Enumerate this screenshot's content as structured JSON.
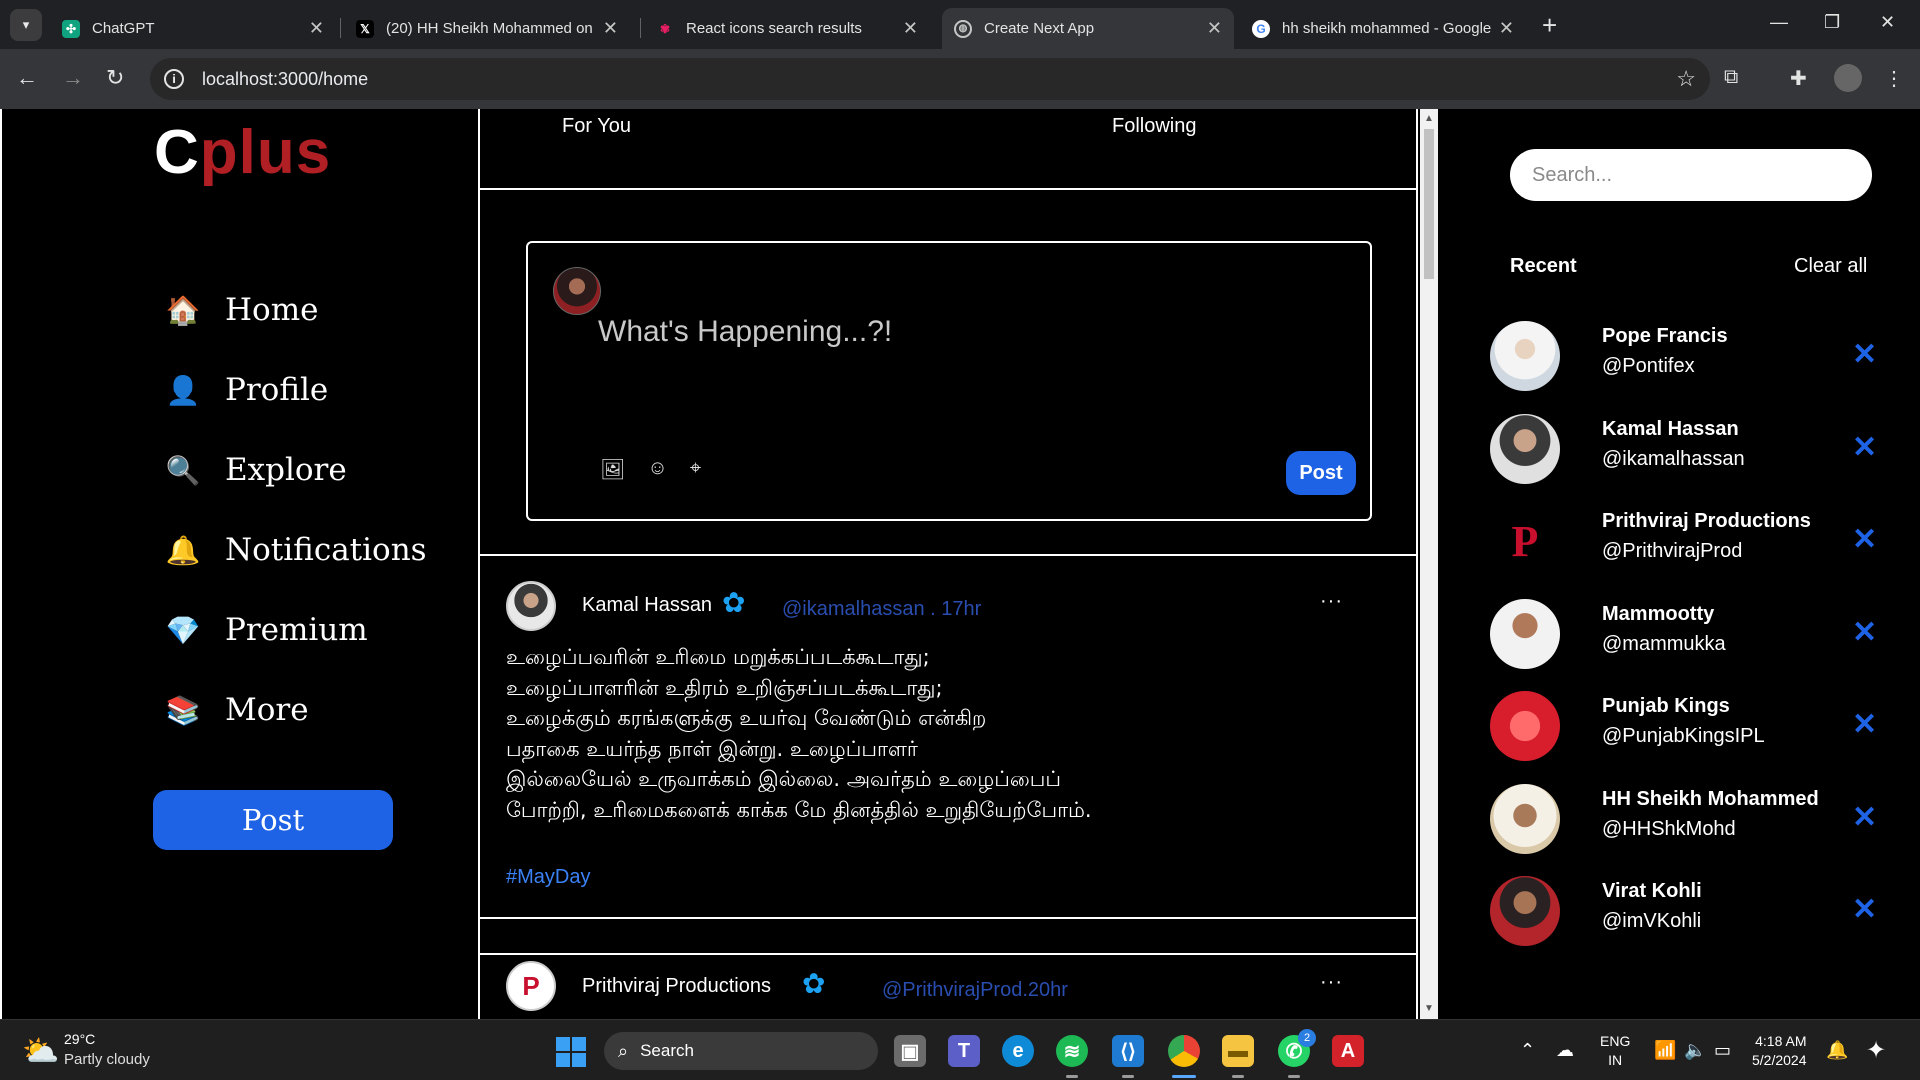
{
  "browser": {
    "tabs": [
      {
        "title": "ChatGPT",
        "favicon": "chatgpt-icon"
      },
      {
        "title": "(20) HH Sheikh Mohammed on",
        "favicon": "x-icon"
      },
      {
        "title": "React icons search results",
        "favicon": "react-icons-icon"
      },
      {
        "title": "Create Next App",
        "favicon": "globe-icon"
      },
      {
        "title": "hh sheikh mohammed - Google",
        "favicon": "google-icon"
      }
    ],
    "active_tab": 3,
    "url": "localhost:3000/home"
  },
  "app": {
    "logo_c": "C",
    "logo_rest": "plus",
    "nav": [
      {
        "label": "Home",
        "icon": "house-icon"
      },
      {
        "label": "Profile",
        "icon": "user-icon"
      },
      {
        "label": "Explore",
        "icon": "magnifier-icon"
      },
      {
        "label": "Notifications",
        "icon": "bell-icon"
      },
      {
        "label": "Premium",
        "icon": "gem-icon"
      },
      {
        "label": "More",
        "icon": "books-icon"
      }
    ],
    "post_button": "Post",
    "colors": {
      "accent": "#1e63e6",
      "logo_red": "#b01f24",
      "handle_blue": "#2a4eb0",
      "hashtag_blue": "#3b82f6"
    }
  },
  "feed": {
    "tabs": [
      "For You",
      "Following"
    ],
    "composer": {
      "placeholder": "What's Happening...?!",
      "post_label": "Post"
    },
    "tweets": [
      {
        "name": "Kamal Hassan",
        "handle": "@ikamalhassan . 17hr",
        "lines": [
          "உழைப்பவரின் உரிமை மறுக்கப்படக்கூடாது;",
          "உழைப்பாளரின் உதிரம் உறிஞ்சப்படக்கூடாது;",
          "உழைக்கும் கரங்களுக்கு உயர்வு வேண்டும் என்கிற",
          "பதாகை உயர்ந்த நாள் இன்று. உழைப்பாளர்",
          "இல்லையேல் உருவாக்கம் இல்லை. அவர்தம் உழைப்பைப்",
          "போற்றி, உரிமைகளைக் காக்க மே தினத்தில் உறுதியேற்போம்."
        ],
        "hashtag": "#MayDay"
      },
      {
        "name": "Prithviraj Productions",
        "handle": "@PrithvirajProd.20hr"
      }
    ]
  },
  "sidebar": {
    "search_placeholder": "Search...",
    "recent_title": "Recent",
    "clear_all": "Clear all",
    "recent": [
      {
        "name": "Pope Francis",
        "handle": "@Pontifex"
      },
      {
        "name": "Kamal Hassan",
        "handle": "@ikamalhassan"
      },
      {
        "name": "Prithviraj Productions",
        "handle": "@PrithvirajProd"
      },
      {
        "name": "Mammootty",
        "handle": "@mammukka"
      },
      {
        "name": "Punjab Kings",
        "handle": "@PunjabKingsIPL"
      },
      {
        "name": "HH Sheikh Mohammed",
        "handle": "@HHShkMohd"
      },
      {
        "name": "Virat Kohli",
        "handle": "@imVKohli"
      }
    ]
  },
  "taskbar": {
    "temperature": "29°C",
    "weather": "Partly cloudy",
    "search_label": "Search",
    "lang1": "ENG",
    "lang2": "IN",
    "time": "4:18 AM",
    "date": "5/2/2024",
    "whatsapp_badge": "2"
  }
}
